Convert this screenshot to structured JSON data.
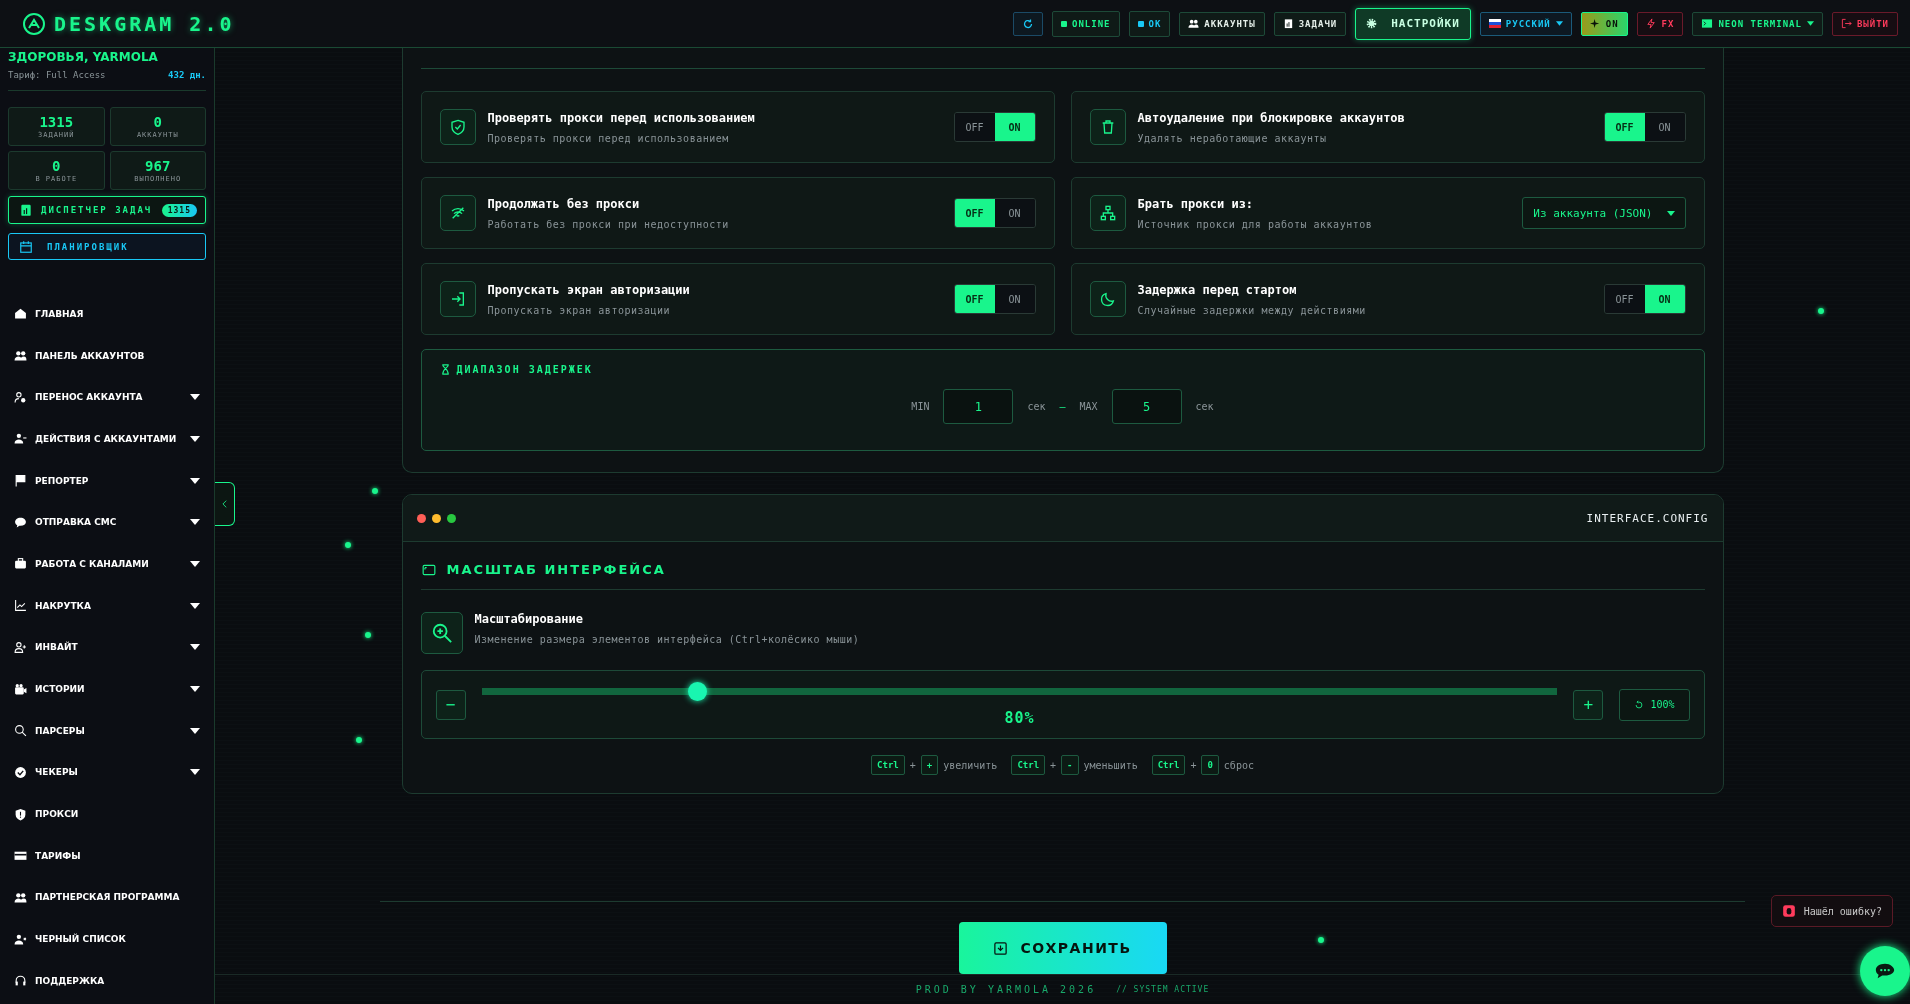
{
  "header": {
    "logo": "DESKGRAM 2.0",
    "items": [
      {
        "kind": "refresh",
        "selected": false
      },
      {
        "kind": "status",
        "label": "ONLINE",
        "color": "#19f58c"
      },
      {
        "kind": "status",
        "label": "OK",
        "color": "#19c8f5"
      },
      {
        "kind": "nav",
        "label": "АККАУНТЫ",
        "selected": false
      },
      {
        "kind": "nav",
        "label": "ЗАДАЧИ",
        "selected": false
      },
      {
        "kind": "nav",
        "label": "НАСТРОЙКИ",
        "selected": true
      },
      {
        "kind": "language",
        "label": "РУССКИЙ"
      },
      {
        "kind": "power",
        "label": "ON"
      },
      {
        "kind": "fx",
        "label": "FX"
      },
      {
        "kind": "theme",
        "label": "NEON TERMINAL"
      },
      {
        "kind": "logout",
        "label": "ВЫЙТИ"
      }
    ]
  },
  "sidebar": {
    "greeting": "ЗДОРОВЬЯ, YARMOLA",
    "tariff": "Тариф: Full Access",
    "days": "432 дн.",
    "stats": [
      {
        "value": "1315",
        "label": "ЗАДАНИЙ"
      },
      {
        "value": "0",
        "label": "АККАУНТЫ"
      },
      {
        "value": "0",
        "label": "В РАБОТЕ"
      },
      {
        "value": "967",
        "label": "ВЫПОЛНЕНО"
      }
    ],
    "dispatcher": {
      "label": "ДИСПЕТЧЕР ЗАДАЧ",
      "badge": "1315"
    },
    "scheduler": {
      "label": "ПЛАНИРОВЩИК"
    },
    "items": [
      {
        "label": "ГЛАВНАЯ",
        "expandable": false
      },
      {
        "label": "ПАНЕЛЬ АККАУНТОВ",
        "expandable": false
      },
      {
        "label": "ПЕРЕНОС АККАУНТА",
        "expandable": true
      },
      {
        "label": "ДЕЙСТВИЯ С АККАУНТАМИ",
        "expandable": true
      },
      {
        "label": "РЕПОРТЕР",
        "expandable": true
      },
      {
        "label": "ОТПРАВКА СМС",
        "expandable": true
      },
      {
        "label": "РАБОТА С КАНАЛАМИ",
        "expandable": true
      },
      {
        "label": "НАКРУТКА",
        "expandable": true
      },
      {
        "label": "ИНВАЙТ",
        "expandable": true
      },
      {
        "label": "ИСТОРИИ",
        "expandable": true
      },
      {
        "label": "ПАРСЕРЫ",
        "expandable": true
      },
      {
        "label": "ЧЕКЕРЫ",
        "expandable": true
      },
      {
        "label": "ПРОКСИ",
        "expandable": false
      },
      {
        "label": "ТАРИФЫ",
        "expandable": false
      },
      {
        "label": "ПАРТНЕРСКАЯ ПРОГРАММА",
        "expandable": false
      },
      {
        "label": "ЧЕРНЫЙ СПИСОК",
        "expandable": false
      },
      {
        "label": "ПОДДЕРЖКА",
        "expandable": false
      }
    ]
  },
  "proxy_settings": {
    "cards": [
      {
        "kind": "toggle",
        "title": "Проверять прокси перед использованием",
        "subtitle": "Проверять прокси перед использованием",
        "off_label": "OFF",
        "on_label": "ON",
        "on": true
      },
      {
        "kind": "toggle",
        "title": "Автоудаление при блокировке аккаунтов",
        "subtitle": "Удалять неработающие аккаунты",
        "off_label": "OFF",
        "on_label": "ON",
        "on": false
      },
      {
        "kind": "toggle",
        "title": "Продолжать без прокси",
        "subtitle": "Работать без прокси при недоступности",
        "off_label": "OFF",
        "on_label": "ON",
        "on": false
      },
      {
        "kind": "select",
        "title": "Брать прокси из:",
        "subtitle": "Источник прокси для работы аккаунтов",
        "value": "Из аккаунта (JSON)"
      },
      {
        "kind": "toggle",
        "title": "Пропускать экран авторизации",
        "subtitle": "Пропускать экран авторизации",
        "off_label": "OFF",
        "on_label": "ON",
        "on": false
      },
      {
        "kind": "toggle",
        "title": "Задержка перед стартом",
        "subtitle": "Случайные задержки между действиями",
        "off_label": "OFF",
        "on_label": "ON",
        "on": true
      }
    ],
    "delay_range": {
      "title": "ДИАПАЗОН ЗАДЕРЖЕК",
      "min_label": "MIN",
      "min": "1",
      "min_unit": "сек",
      "dash": "—",
      "max_label": "MAX",
      "max": "5",
      "max_unit": "сек"
    }
  },
  "interface_panel": {
    "window_label": "INTERFACE.CONFIG",
    "section_title": "МАСШТАБ ИНТЕРФЕЙСА",
    "setting_title": "Масштабирование",
    "setting_subtitle": "Изменение размера элементов интерфейса (Ctrl+колёсико мыши)",
    "minus": "−",
    "plus": "+",
    "level": 0.2,
    "reading": "80%",
    "reset": "100%",
    "shortcuts": [
      {
        "keys": [
          "Ctrl",
          "+"
        ],
        "joiner": "+",
        "label": "увеличить"
      },
      {
        "keys": [
          "Ctrl",
          "-"
        ],
        "joiner": "+",
        "label": "уменьшить"
      },
      {
        "keys": [
          "Ctrl",
          "0"
        ],
        "joiner": "+",
        "label": "сброс"
      }
    ]
  },
  "save_button": "СОХРАНИТЬ",
  "footer": {
    "credit": "PROD BY YARMOLA 2026",
    "status": "// SYSTEM ACTIVE"
  },
  "bug_report": "Нашёл ошибку?"
}
